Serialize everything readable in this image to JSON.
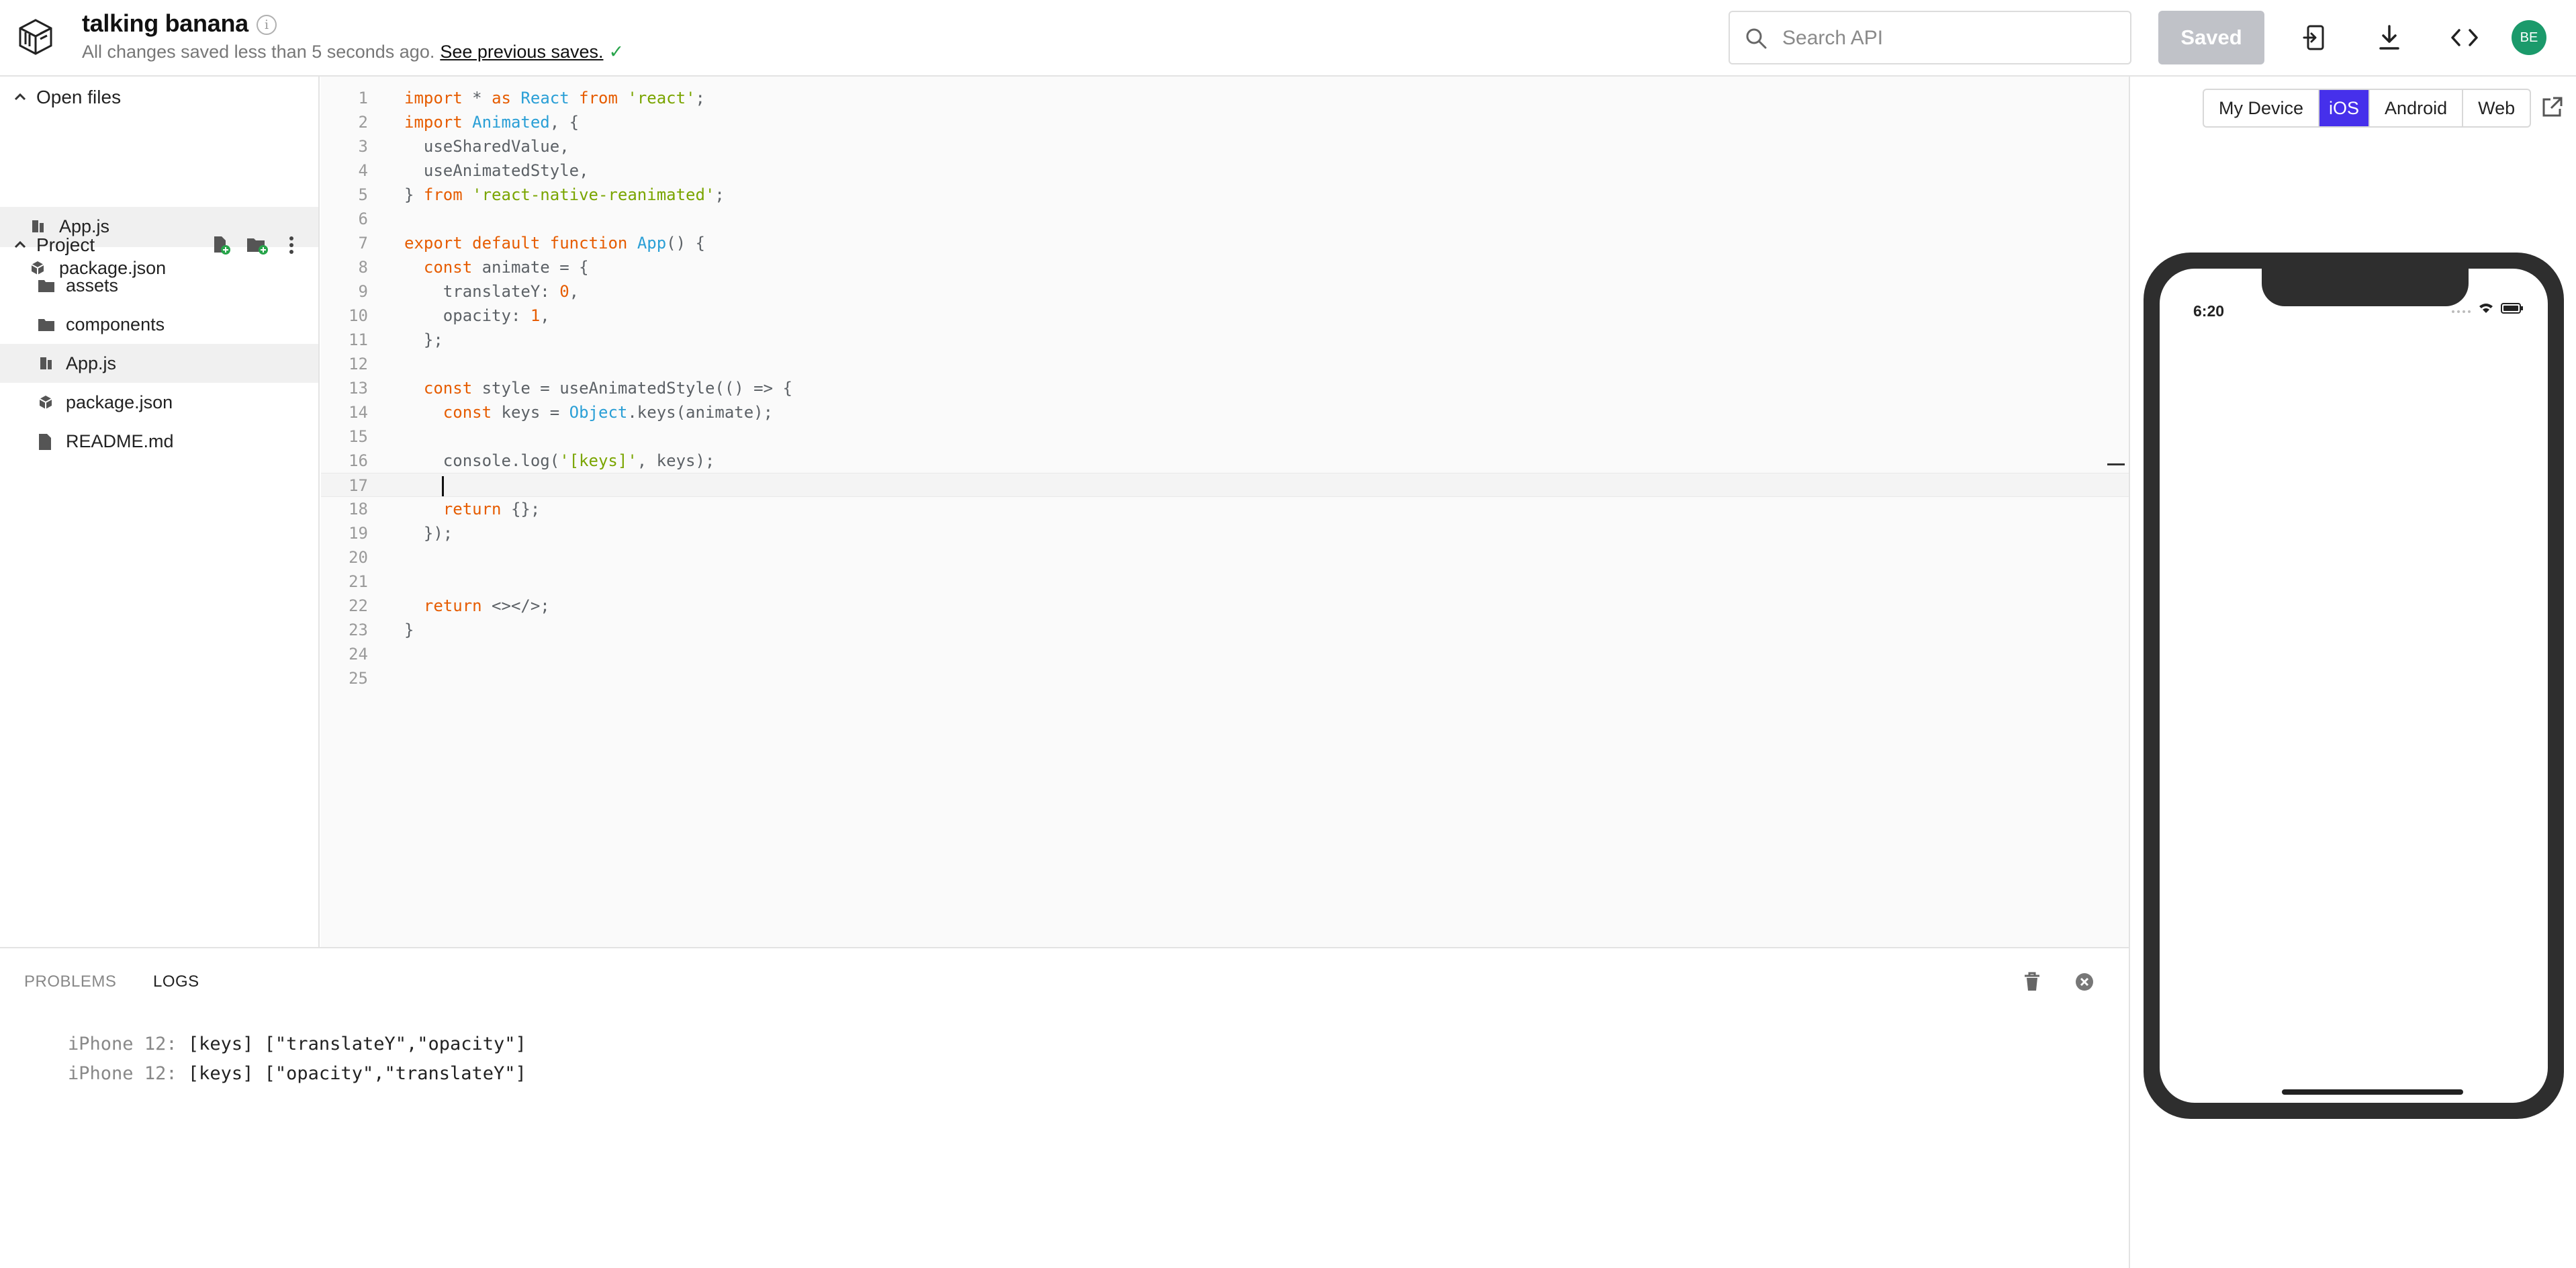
{
  "header": {
    "project_name": "talking banana",
    "info_icon": "info-icon",
    "save_status": "All changes saved less than 5 seconds ago.",
    "previous_saves_link": "See previous saves.",
    "search_placeholder": "Search API",
    "saved_button": "Saved",
    "avatar_initials": "BE"
  },
  "sidebar": {
    "open_files_title": "Open files",
    "open_files": [
      {
        "name": "App.js",
        "icon": "react-file-icon"
      },
      {
        "name": "package.json",
        "icon": "package-icon"
      }
    ],
    "project_title": "Project",
    "project_items": [
      {
        "name": "assets",
        "icon": "folder-icon"
      },
      {
        "name": "components",
        "icon": "folder-icon"
      },
      {
        "name": "App.js",
        "icon": "react-file-icon"
      },
      {
        "name": "package.json",
        "icon": "package-icon"
      },
      {
        "name": "README.md",
        "icon": "file-icon"
      }
    ]
  },
  "editor": {
    "current_line": 17,
    "lines": [
      "import * as React from 'react';",
      "import Animated, {",
      "  useSharedValue,",
      "  useAnimatedStyle,",
      "} from 'react-native-reanimated';",
      "",
      "export default function App() {",
      "  const animate = {",
      "    translateY: 0,",
      "    opacity: 1,",
      "  };",
      "",
      "  const style = useAnimatedStyle(() => {",
      "    const keys = Object.keys(animate);",
      "",
      "    console.log('[keys]', keys);",
      "",
      "    return {};",
      "  });",
      "",
      "",
      "  return <></>;",
      "}",
      "",
      ""
    ]
  },
  "panel": {
    "tabs": [
      "PROBLEMS",
      "LOGS"
    ],
    "active_tab": "LOGS",
    "logs": [
      {
        "device": "iPhone 12:",
        "message": "[keys] [\"translateY\",\"opacity\"]"
      },
      {
        "device": "iPhone 12:",
        "message": "[keys] [\"opacity\",\"translateY\"]"
      }
    ]
  },
  "preview": {
    "platforms": [
      "My Device",
      "iOS",
      "Android",
      "Web"
    ],
    "active_platform": "iOS",
    "phone_time": "6:20"
  },
  "colors": {
    "accent": "#4630eb",
    "keyword": "#e65c00",
    "string": "#7aa500",
    "class": "#2a9fd6",
    "avatar": "#1b9a6b",
    "saved_button": "#c0c2c8"
  }
}
